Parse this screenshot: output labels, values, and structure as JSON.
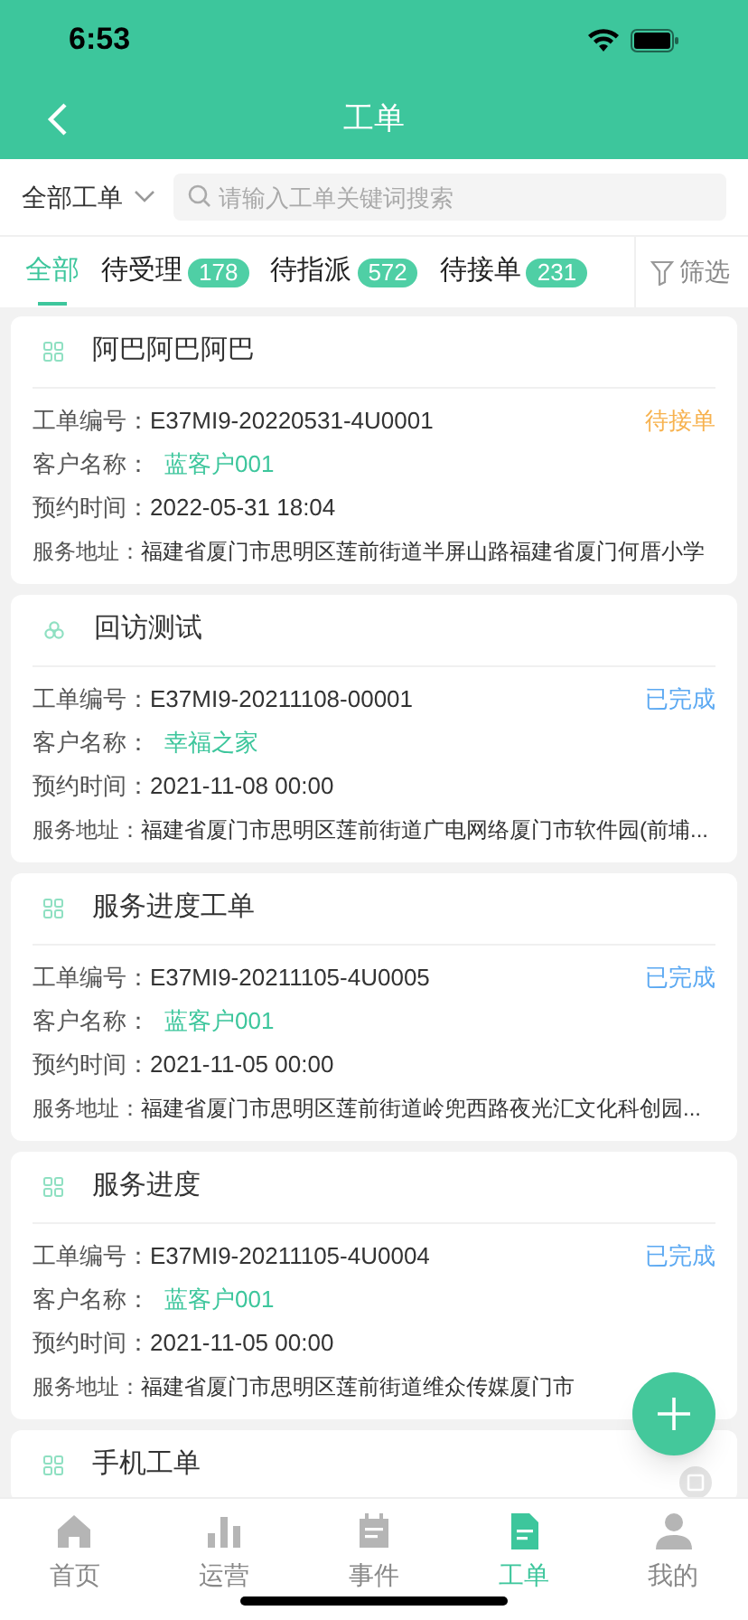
{
  "status_bar": {
    "time": "6:53"
  },
  "nav": {
    "title": "工单"
  },
  "filter": {
    "scope": "全部工单",
    "search_placeholder": "请输入工单关键词搜索"
  },
  "tabs": [
    {
      "label": "全部",
      "selected": true
    },
    {
      "label": "待受理",
      "count": "178",
      "selected": false
    },
    {
      "label": "待指派",
      "count": "572",
      "selected": false
    },
    {
      "label": "待接单",
      "count": "231",
      "selected": false
    }
  ],
  "filter_button": "筛选",
  "orders": [
    {
      "kind": "grid",
      "title": "阿巴阿巴阿巴",
      "fields": [
        {
          "label": "工单编号：",
          "value": "E37MI9-20220531-4U0001",
          "kind": "plain"
        },
        {
          "label": "客户名称：",
          "value": "蓝客户001",
          "kind": "customer"
        },
        {
          "label": "预约时间：",
          "value": "2022-05-31 18:04",
          "kind": "plain"
        },
        {
          "label": "服务地址：",
          "value": "福建省厦门市思明区莲前街道半屏山路福建省厦门何厝小学",
          "kind": "plain"
        }
      ],
      "status": {
        "text": "待接单",
        "color": "#f7b24f"
      }
    },
    {
      "kind": "flower",
      "title": "回访测试",
      "fields": [
        {
          "label": "工单编号：",
          "value": "E37MI9-20211108-00001",
          "kind": "plain"
        },
        {
          "label": "客户名称：",
          "value": "幸福之家",
          "kind": "customer"
        },
        {
          "label": "预约时间：",
          "value": "2021-11-08 00:00",
          "kind": "plain"
        },
        {
          "label": "服务地址：",
          "value": "福建省厦门市思明区莲前街道广电网络厦门市软件园(前埔...",
          "kind": "plain"
        }
      ],
      "status": {
        "text": "已完成",
        "color": "#5ca9f2"
      }
    },
    {
      "kind": "grid",
      "title": "服务进度工单",
      "fields": [
        {
          "label": "工单编号：",
          "value": "E37MI9-20211105-4U0005",
          "kind": "plain"
        },
        {
          "label": "客户名称：",
          "value": "蓝客户001",
          "kind": "customer"
        },
        {
          "label": "预约时间：",
          "value": "2021-11-05 00:00",
          "kind": "plain"
        },
        {
          "label": "服务地址：",
          "value": "福建省厦门市思明区莲前街道岭兜西路夜光汇文化科创园...",
          "kind": "plain"
        }
      ],
      "status": {
        "text": "已完成",
        "color": "#5ca9f2"
      }
    },
    {
      "kind": "grid",
      "title": "服务进度",
      "fields": [
        {
          "label": "工单编号：",
          "value": "E37MI9-20211105-4U0004",
          "kind": "plain"
        },
        {
          "label": "客户名称：",
          "value": "蓝客户001",
          "kind": "customer"
        },
        {
          "label": "预约时间：",
          "value": "2021-11-05 00:00",
          "kind": "plain"
        },
        {
          "label": "服务地址：",
          "value": "福建省厦门市思明区莲前街道维众传媒厦门市",
          "kind": "plain"
        }
      ],
      "status": {
        "text": "已完成",
        "color": "#5ca9f2"
      }
    },
    {
      "kind": "grid",
      "title": "手机工单"
    }
  ],
  "tabbar": [
    {
      "label": "首页",
      "selected": false
    },
    {
      "label": "运营",
      "selected": false
    },
    {
      "label": "事件",
      "selected": false
    },
    {
      "label": "工单",
      "selected": true
    },
    {
      "label": "我的",
      "selected": false
    }
  ]
}
